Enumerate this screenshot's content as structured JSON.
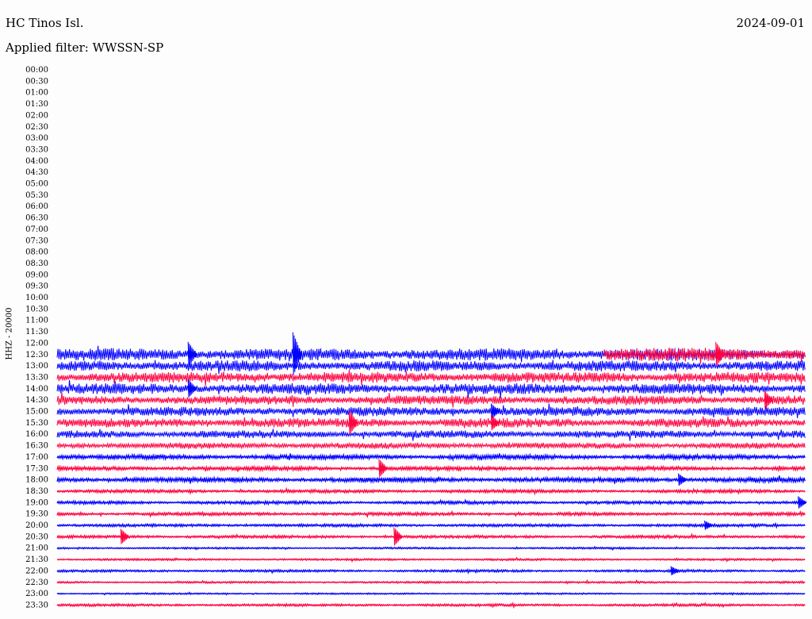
{
  "header": {
    "station": "HC Tinos Isl.",
    "date": "2024-09-01",
    "filter": "Applied filter: WWSSN-SP"
  },
  "channel_label": "HHZ - 20000",
  "colors": {
    "odd_rows": "#0000ff",
    "even_rows": "#ff0040"
  },
  "chart_data": {
    "type": "line",
    "title": "",
    "xlabel": "",
    "ylabel": "HHZ - 20000",
    "row_interval_minutes": 30,
    "y_tick_labels": [
      "00:00",
      "00:30",
      "01:00",
      "01:30",
      "02:00",
      "02:30",
      "03:00",
      "03:30",
      "04:00",
      "04:30",
      "05:00",
      "05:30",
      "06:00",
      "06:30",
      "07:00",
      "07:30",
      "08:00",
      "08:30",
      "09:00",
      "09:30",
      "10:00",
      "10:30",
      "11:00",
      "11:30",
      "12:00",
      "12:30",
      "13:00",
      "13:30",
      "14:00",
      "14:30",
      "15:00",
      "15:30",
      "16:00",
      "16:30",
      "17:00",
      "17:30",
      "18:00",
      "18:30",
      "19:00",
      "19:30",
      "20:00",
      "20:30",
      "21:00",
      "21:30",
      "22:00",
      "22:30",
      "23:00",
      "23:30"
    ],
    "series": [
      {
        "time": "12:30",
        "color": "blue",
        "amplitude": 8,
        "starts_at_fraction": 0
      },
      {
        "time": "12:30",
        "color": "red",
        "amplitude": 9,
        "starts_at_fraction": 0.73
      },
      {
        "time": "13:00",
        "color": "blue",
        "amplitude": 7
      },
      {
        "time": "13:30",
        "color": "red",
        "amplitude": 7
      },
      {
        "time": "14:00",
        "color": "blue",
        "amplitude": 7
      },
      {
        "time": "14:30",
        "color": "red",
        "amplitude": 6
      },
      {
        "time": "15:00",
        "color": "blue",
        "amplitude": 6
      },
      {
        "time": "15:30",
        "color": "red",
        "amplitude": 6
      },
      {
        "time": "16:00",
        "color": "blue",
        "amplitude": 5
      },
      {
        "time": "16:30",
        "color": "red",
        "amplitude": 4
      },
      {
        "time": "17:00",
        "color": "blue",
        "amplitude": 3
      },
      {
        "time": "17:30",
        "color": "red",
        "amplitude": 2.5
      },
      {
        "time": "18:00",
        "color": "blue",
        "amplitude": 3
      },
      {
        "time": "18:30",
        "color": "red",
        "amplitude": 2
      },
      {
        "time": "19:00",
        "color": "blue",
        "amplitude": 2
      },
      {
        "time": "19:30",
        "color": "red",
        "amplitude": 2
      },
      {
        "time": "20:00",
        "color": "blue",
        "amplitude": 1.8
      },
      {
        "time": "20:30",
        "color": "red",
        "amplitude": 1.8
      },
      {
        "time": "21:00",
        "color": "blue",
        "amplitude": 1.2
      },
      {
        "time": "21:30",
        "color": "red",
        "amplitude": 1.2
      },
      {
        "time": "22:00",
        "color": "blue",
        "amplitude": 1.5
      },
      {
        "time": "22:30",
        "color": "red",
        "amplitude": 1.2
      },
      {
        "time": "23:00",
        "color": "blue",
        "amplitude": 1.0
      },
      {
        "time": "23:30",
        "color": "red",
        "amplitude": 1.6
      }
    ],
    "events": [
      {
        "time": "12:30",
        "at_fraction": 0.175,
        "height": 16,
        "color": "blue"
      },
      {
        "time": "12:30",
        "at_fraction": 0.315,
        "height": 28,
        "color": "blue"
      },
      {
        "time": "12:30",
        "at_fraction": 0.88,
        "height": 16,
        "color": "red"
      },
      {
        "time": "14:00",
        "at_fraction": 0.175,
        "height": 12,
        "color": "blue"
      },
      {
        "time": "14:30",
        "at_fraction": 0.945,
        "height": 12,
        "color": "red"
      },
      {
        "time": "15:00",
        "at_fraction": 0.58,
        "height": 10,
        "color": "blue"
      },
      {
        "time": "15:30",
        "at_fraction": 0.39,
        "height": 16,
        "color": "red"
      },
      {
        "time": "15:30",
        "at_fraction": 0.58,
        "height": 10,
        "color": "red"
      },
      {
        "time": "17:30",
        "at_fraction": 0.43,
        "height": 12,
        "color": "red"
      },
      {
        "time": "18:00",
        "at_fraction": 0.83,
        "height": 8,
        "color": "blue"
      },
      {
        "time": "19:00",
        "at_fraction": 0.99,
        "height": 8,
        "color": "blue"
      },
      {
        "time": "20:00",
        "at_fraction": 0.865,
        "height": 6,
        "color": "blue"
      },
      {
        "time": "20:30",
        "at_fraction": 0.085,
        "height": 10,
        "color": "red"
      },
      {
        "time": "20:30",
        "at_fraction": 0.45,
        "height": 12,
        "color": "red"
      },
      {
        "time": "22:00",
        "at_fraction": 0.82,
        "height": 6,
        "color": "blue"
      }
    ]
  }
}
